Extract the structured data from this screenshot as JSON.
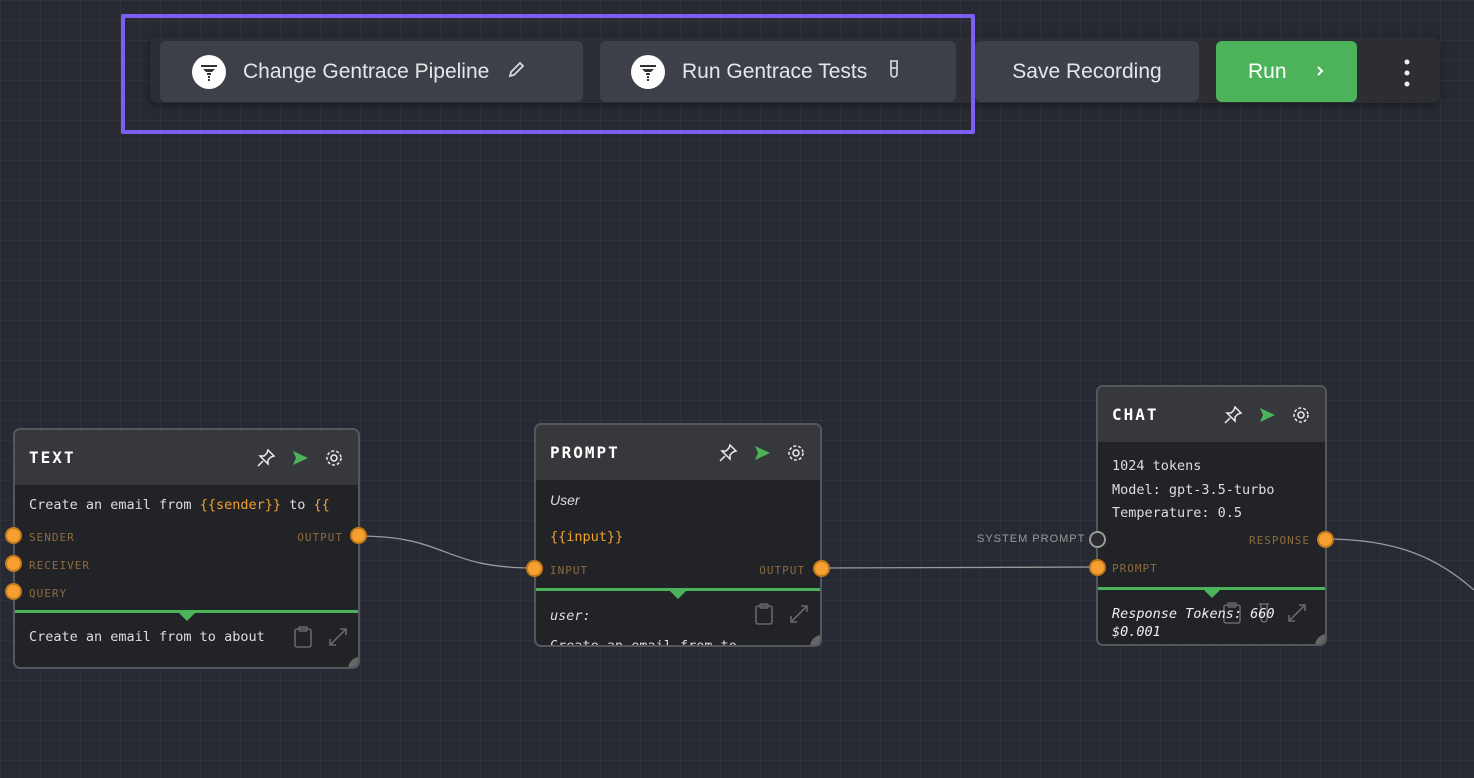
{
  "toolbar": {
    "change_pipeline": "Change Gentrace Pipeline",
    "run_tests": "Run Gentrace Tests",
    "save_recording": "Save Recording",
    "run": "Run",
    "run_color": "#4cb35a",
    "highlight_color": "#7b5ef2"
  },
  "nodes": {
    "text": {
      "title": "TEXT",
      "template_prefix": "Create an email from ",
      "template_var": "{{sender}}",
      "template_mid": " to ",
      "template_tail": "{{",
      "inputs": [
        "SENDER",
        "RECEIVER",
        "QUERY"
      ],
      "output": "OUTPUT",
      "preview": "Create an email from  to  about"
    },
    "prompt": {
      "title": "PROMPT",
      "role": "User",
      "template": "{{input}}",
      "input": "INPUT",
      "output": "OUTPUT",
      "preview_role": "user:",
      "preview_text": "Create an email from  to"
    },
    "chat": {
      "title": "CHAT",
      "tokens": "1024 tokens",
      "model": "Model: gpt-3.5-turbo",
      "temperature": "Temperature: 0.5",
      "system_prompt": "SYSTEM PROMPT",
      "prompt": "PROMPT",
      "response": "RESPONSE",
      "response_tokens": "Response Tokens: 660",
      "cost": "$0.001"
    }
  }
}
